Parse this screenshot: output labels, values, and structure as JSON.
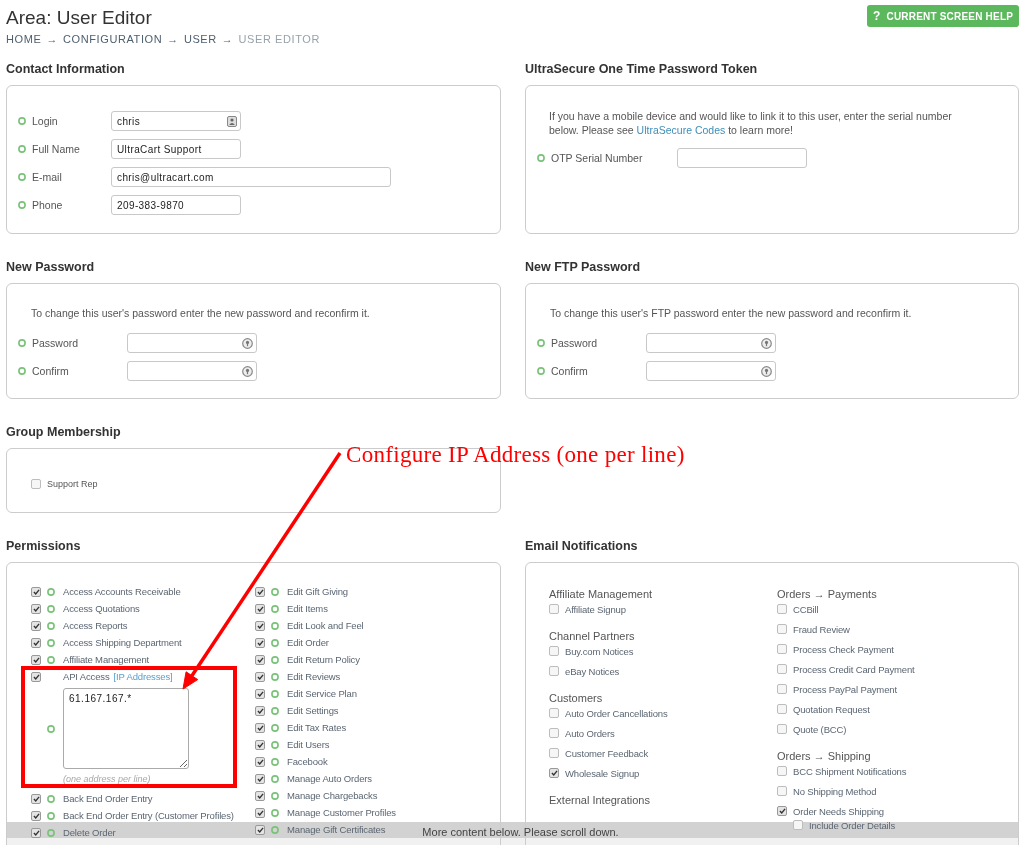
{
  "header": {
    "title": "Area: User Editor",
    "breadcrumb": [
      {
        "label": "HOME",
        "separator": "→",
        "current": false
      },
      {
        "label": "CONFIGURATION",
        "separator": "→",
        "current": false
      },
      {
        "label": "USER",
        "separator": "→",
        "current": false
      },
      {
        "label": "USER EDITOR",
        "current": true
      }
    ],
    "help_button": {
      "icon": "?",
      "label": "CURRENT SCREEN HELP"
    }
  },
  "contact_information": {
    "title": "Contact Information",
    "fields": [
      {
        "label": "Login",
        "kind": "login",
        "value": "chris"
      },
      {
        "label": "Full Name",
        "kind": "text",
        "value": "UltraCart Support"
      },
      {
        "label": "E-mail",
        "kind": "email",
        "value": "chris@ultracart.com"
      },
      {
        "label": "Phone",
        "kind": "text",
        "value": "209-383-9870"
      }
    ]
  },
  "otp_token": {
    "title": "UltraSecure One Time Password Token",
    "intro": "If you have a mobile device and would like to link it to this user, enter the serial number below. Please see ",
    "link": "UltraSecure Codes",
    "intro_end": " to learn more!",
    "fields": [
      {
        "label": "OTP Serial Number",
        "kind": "text"
      }
    ]
  },
  "new_password": {
    "title": "New Password",
    "intro": "To change this user's password enter the new password and reconfirm it.",
    "fields": [
      {
        "label": "Password",
        "kind": "password"
      },
      {
        "label": "Confirm",
        "kind": "password"
      }
    ]
  },
  "new_ftp_password": {
    "title": "New FTP Password",
    "intro": "To change this user's FTP password enter the new password and reconfirm it.",
    "fields": [
      {
        "label": "Password",
        "kind": "password"
      },
      {
        "label": "Confirm",
        "kind": "password"
      }
    ]
  },
  "group_membership": {
    "title": "Group Membership",
    "groups": [
      {
        "label": "Support Rep",
        "checked": false
      }
    ]
  },
  "annotation": {
    "text": "Configure IP Address (one per line)"
  },
  "permissions": {
    "title": "Permissions",
    "columns": [
      {
        "items": [
          {
            "kind": "check",
            "label": "Access Accounts Receivable",
            "checked": true
          },
          {
            "kind": "check",
            "label": "Access Quotations",
            "checked": true
          },
          {
            "kind": "check",
            "label": "Access Reports",
            "checked": true
          },
          {
            "kind": "check",
            "label": "Access Shipping Department",
            "checked": true
          },
          {
            "kind": "check",
            "label": "Affiliate Management",
            "checked": true
          },
          {
            "kind": "ip-list",
            "label": "API Access",
            "link": "[IP Addresses]",
            "checked": true,
            "value": "61.167.167.*",
            "hint": "(one address per line)"
          },
          {
            "kind": "check",
            "label": "Back End Order Entry",
            "checked": true
          },
          {
            "kind": "check",
            "label": "Back End Order Entry (Customer Profiles)",
            "checked": true
          },
          {
            "kind": "check",
            "label": "Delete Order",
            "checked": true
          }
        ]
      },
      {
        "items": [
          {
            "kind": "check",
            "label": "Edit Gift Giving",
            "checked": true
          },
          {
            "kind": "check",
            "label": "Edit Items",
            "checked": true
          },
          {
            "kind": "check",
            "label": "Edit Look and Feel",
            "checked": true
          },
          {
            "kind": "check",
            "label": "Edit Order",
            "checked": true
          },
          {
            "kind": "check",
            "label": "Edit Return Policy",
            "checked": true
          },
          {
            "kind": "check",
            "label": "Edit Reviews",
            "checked": true
          },
          {
            "kind": "check",
            "label": "Edit Service Plan",
            "checked": true
          },
          {
            "kind": "check",
            "label": "Edit Settings",
            "checked": true
          },
          {
            "kind": "check",
            "label": "Edit Tax Rates",
            "checked": true
          },
          {
            "kind": "check",
            "label": "Edit Users",
            "checked": true
          },
          {
            "kind": "check",
            "label": "Facebook",
            "checked": true
          },
          {
            "kind": "check",
            "label": "Manage Auto Orders",
            "checked": true
          },
          {
            "kind": "check",
            "label": "Manage Chargebacks",
            "checked": true
          },
          {
            "kind": "check",
            "label": "Manage Customer Profiles",
            "checked": true
          },
          {
            "kind": "check",
            "label": "Manage Gift Certificates",
            "checked": true
          }
        ]
      }
    ]
  },
  "email_notifications": {
    "title": "Email Notifications",
    "columns": [
      {
        "groups": [
          {
            "heading": "Affiliate Management",
            "items": [
              {
                "label": "Affiliate Signup",
                "checked": false
              }
            ]
          },
          {
            "heading": "Channel Partners",
            "items": [
              {
                "label": "Buy.com Notices",
                "checked": false
              },
              {
                "label": "eBay Notices",
                "checked": false
              }
            ]
          },
          {
            "heading": "Customers",
            "items": [
              {
                "label": "Auto Order Cancellations",
                "checked": false
              },
              {
                "label": "Auto Orders",
                "checked": false
              },
              {
                "label": "Customer Feedback",
                "checked": false
              },
              {
                "label": "Wholesale Signup",
                "checked": true
              }
            ]
          },
          {
            "heading": "External Integrations"
          }
        ]
      },
      {
        "groups": [
          {
            "heading": "Orders → Payments",
            "items": [
              {
                "label": "CCBill",
                "checked": false
              },
              {
                "label": "Fraud Review",
                "checked": false
              },
              {
                "label": "Process Check Payment",
                "checked": false
              },
              {
                "label": "Process Credit Card Payment",
                "checked": false
              },
              {
                "label": "Process PayPal Payment",
                "checked": false
              },
              {
                "label": "Quotation Request",
                "checked": false
              },
              {
                "label": "Quote (BCC)",
                "checked": false
              }
            ]
          },
          {
            "heading": "Orders → Shipping",
            "items": [
              {
                "label": "BCC Shipment Notifications",
                "checked": false
              },
              {
                "label": "No Shipping Method",
                "checked": false
              },
              {
                "label": "Order Needs Shipping",
                "checked": true,
                "children": [
                  {
                    "label": "Include Order Details",
                    "checked": false
                  }
                ]
              }
            ]
          }
        ]
      }
    ]
  },
  "scroll_notice": "More content below. Please scroll down."
}
